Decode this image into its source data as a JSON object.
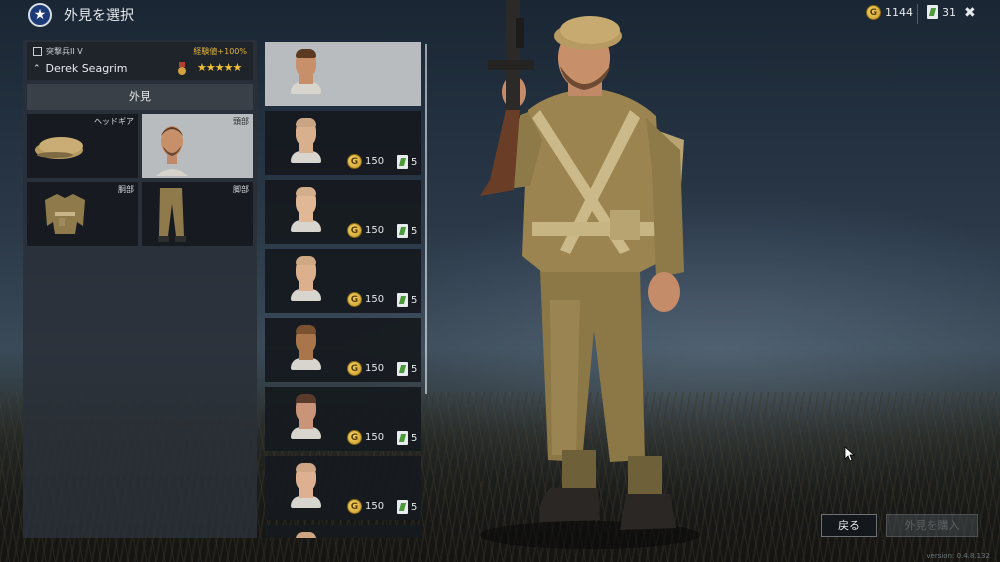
{
  "header": {
    "title": "外見を選択",
    "silver_value": "1144",
    "ticket_value": "31"
  },
  "soldier": {
    "rank": "突撃兵II V",
    "xp_bonus": "経験値+100%",
    "name": "Derek Seagrim",
    "stars": "★★★★★"
  },
  "appearance": {
    "section_title": "外見",
    "slots": [
      {
        "label": "ヘッドギア"
      },
      {
        "label": "頭部"
      },
      {
        "label": "胴部"
      },
      {
        "label": "脚部"
      }
    ]
  },
  "items": [
    {
      "price": "",
      "tickets": "",
      "skin": "#c8906a",
      "hair": "#5a3a22"
    },
    {
      "price": "150",
      "tickets": "5",
      "skin": "#d9b08e",
      "hair": "#c9a586"
    },
    {
      "price": "150",
      "tickets": "5",
      "skin": "#e0b896",
      "hair": "#d2ae8c"
    },
    {
      "price": "150",
      "tickets": "5",
      "skin": "#dcb08c",
      "hair": "#cfa884"
    },
    {
      "price": "150",
      "tickets": "5",
      "skin": "#a8764a",
      "hair": "#7a5230"
    },
    {
      "price": "150",
      "tickets": "5",
      "skin": "#c99478",
      "hair": "#5a3a2a"
    },
    {
      "price": "150",
      "tickets": "5",
      "skin": "#dcb090",
      "hair": "#cfa684"
    },
    {
      "price": "",
      "tickets": "",
      "skin": "#dcb090",
      "hair": "#cfa684"
    }
  ],
  "buttons": {
    "back": "戻る",
    "buy": "外見を購入"
  },
  "version": "version: 0.4.8.132",
  "colors": {
    "accent_gold": "#e3b33b",
    "star": "#f0c030",
    "selected_bg": "#b9bcbf"
  }
}
